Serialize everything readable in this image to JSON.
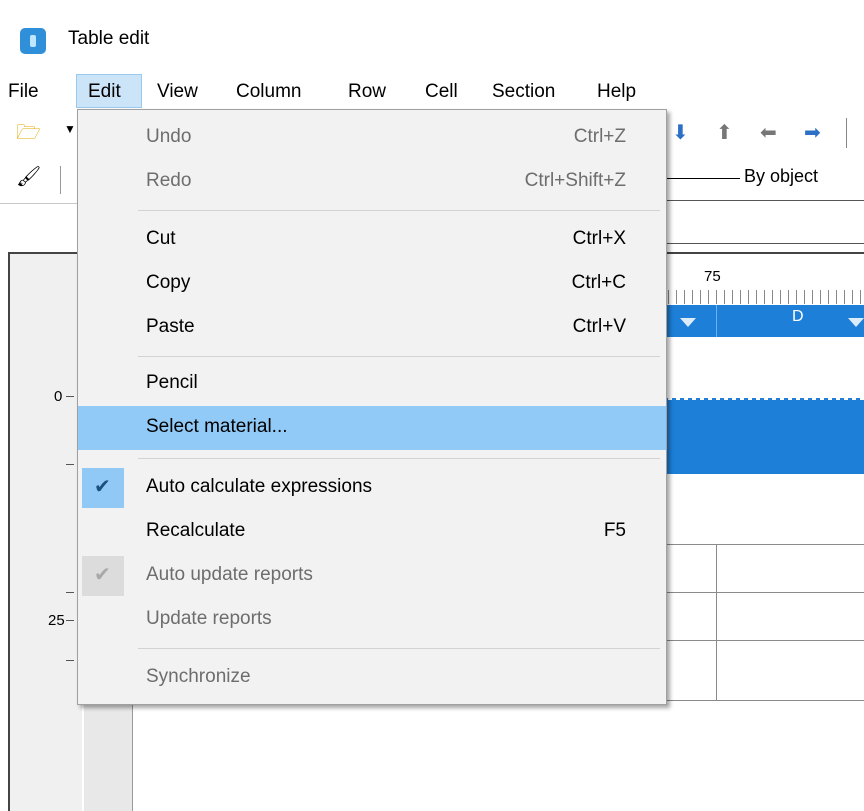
{
  "window": {
    "title": "Table edit"
  },
  "menubar": {
    "items": [
      {
        "label": "File"
      },
      {
        "label": "Edit"
      },
      {
        "label": "View"
      },
      {
        "label": "Column"
      },
      {
        "label": "Row"
      },
      {
        "label": "Cell"
      },
      {
        "label": "Section"
      },
      {
        "label": "Help"
      }
    ]
  },
  "toolbar": {
    "line_style_label": "By object"
  },
  "rulers": {
    "v_top": "0",
    "v_mid": "25",
    "h_mark": "75"
  },
  "grid": {
    "column_d": "D"
  },
  "edit_menu": {
    "items": [
      {
        "label": "Undo",
        "shortcut": "Ctrl+Z",
        "enabled": false
      },
      {
        "label": "Redo",
        "shortcut": "Ctrl+Shift+Z",
        "enabled": false
      },
      {
        "label": "Cut",
        "shortcut": "Ctrl+X",
        "enabled": true
      },
      {
        "label": "Copy",
        "shortcut": "Ctrl+C",
        "enabled": true
      },
      {
        "label": "Paste",
        "shortcut": "Ctrl+V",
        "enabled": true
      },
      {
        "label": "Pencil",
        "shortcut": "",
        "enabled": true
      },
      {
        "label": "Select material...",
        "shortcut": "",
        "enabled": true,
        "highlighted": true
      },
      {
        "label": "Auto calculate expressions",
        "shortcut": "",
        "enabled": true,
        "checked": true
      },
      {
        "label": "Recalculate",
        "shortcut": "F5",
        "enabled": true
      },
      {
        "label": "Auto update reports",
        "shortcut": "",
        "enabled": false,
        "checked": true
      },
      {
        "label": "Update reports",
        "shortcut": "",
        "enabled": false
      },
      {
        "label": "Synchronize",
        "shortcut": "",
        "enabled": false
      }
    ]
  },
  "icons": [
    "app-icon",
    "folder-icon",
    "dropdown-arrow-icon",
    "arrow-down-icon",
    "arrow-up-icon",
    "arrow-left-icon",
    "arrow-right-icon",
    "paint-brush-icon",
    "check-icon"
  ],
  "colors": {
    "accent": "#1e7fd8",
    "highlight": "#91c9f7",
    "menu_bg": "#f2f2f2"
  }
}
